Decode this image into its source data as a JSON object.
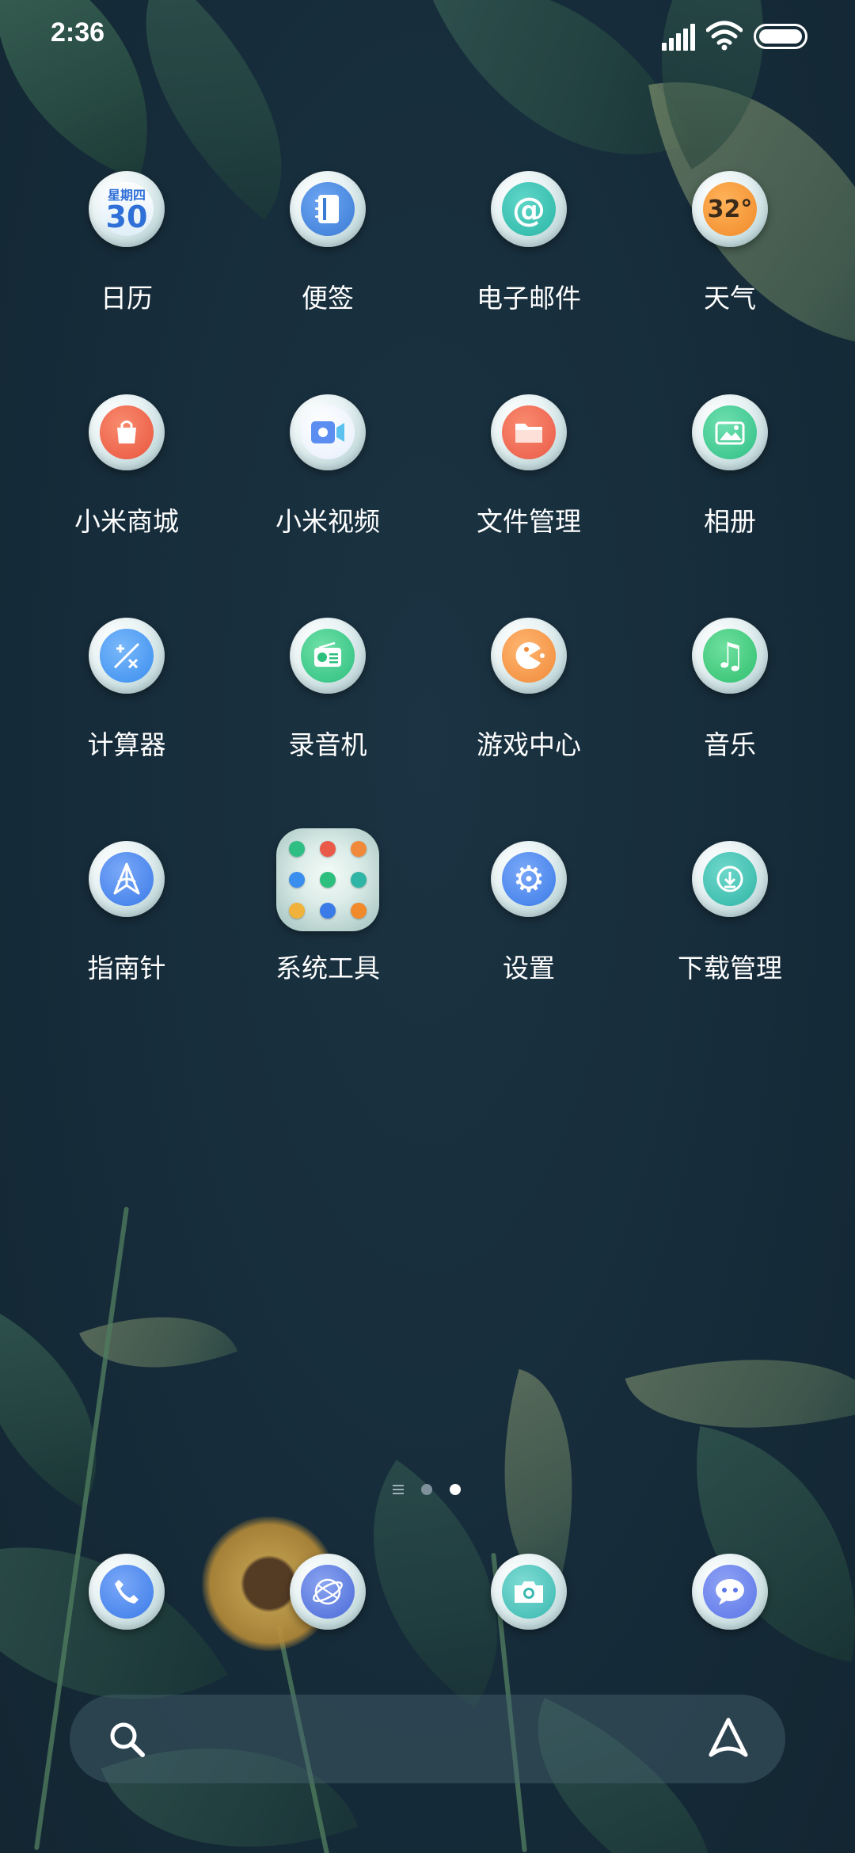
{
  "status_bar": {
    "time": "2:36"
  },
  "apps": [
    {
      "label": "日历",
      "icon": "calendar-icon",
      "calendar_weekday": "星期四",
      "calendar_day": "30"
    },
    {
      "label": "便签",
      "icon": "notes-icon"
    },
    {
      "label": "电子邮件",
      "icon": "email-icon",
      "glyph": "@"
    },
    {
      "label": "天气",
      "icon": "weather-icon",
      "glyph": "32°"
    },
    {
      "label": "小米商城",
      "icon": "mi-store-icon"
    },
    {
      "label": "小米视频",
      "icon": "mi-video-icon"
    },
    {
      "label": "文件管理",
      "icon": "file-manager-icon"
    },
    {
      "label": "相册",
      "icon": "gallery-icon"
    },
    {
      "label": "计算器",
      "icon": "calculator-icon"
    },
    {
      "label": "录音机",
      "icon": "recorder-icon"
    },
    {
      "label": "游戏中心",
      "icon": "game-center-icon"
    },
    {
      "label": "音乐",
      "icon": "music-icon",
      "glyph": "♫"
    },
    {
      "label": "指南针",
      "icon": "compass-icon"
    },
    {
      "label": "系统工具",
      "icon": "folder-icon"
    },
    {
      "label": "设置",
      "icon": "gear-icon",
      "glyph": "⚙"
    },
    {
      "label": "下载管理",
      "icon": "download-icon"
    }
  ],
  "page_indicator": {
    "pages": 2,
    "current_page": 2
  },
  "dock": [
    {
      "icon": "phone-icon"
    },
    {
      "icon": "browser-icon"
    },
    {
      "icon": "camera-icon"
    },
    {
      "icon": "messages-icon"
    }
  ],
  "search_bar": {
    "search_icon": "search-icon",
    "assistant_icon": "assistant-icon"
  },
  "colors": {
    "background": "#162c3a",
    "calendar_blue": "#2e6fd8",
    "notes_blue": "#3a7bd5",
    "email_teal": "#2bb6a6",
    "weather_orange": "#f08a2a",
    "store_red": "#e8553e",
    "video_blue": "#5b8ef0",
    "files_red": "#ea5a48",
    "gallery_green": "#2fbf85",
    "calculator_blue": "#3a8ef0",
    "recorder_green": "#2cbf7e",
    "game_orange": "#f08a3a",
    "music_green": "#2fbf6e",
    "compass_blue": "#3a7be8",
    "settings_blue": "#3a7be8",
    "download_teal": "#2fb5a5",
    "phone_blue": "#3a7be8",
    "browser_indigo": "#4a6ad8",
    "camera_teal": "#3ab8b0",
    "messages_indigo": "#5b76e8"
  }
}
